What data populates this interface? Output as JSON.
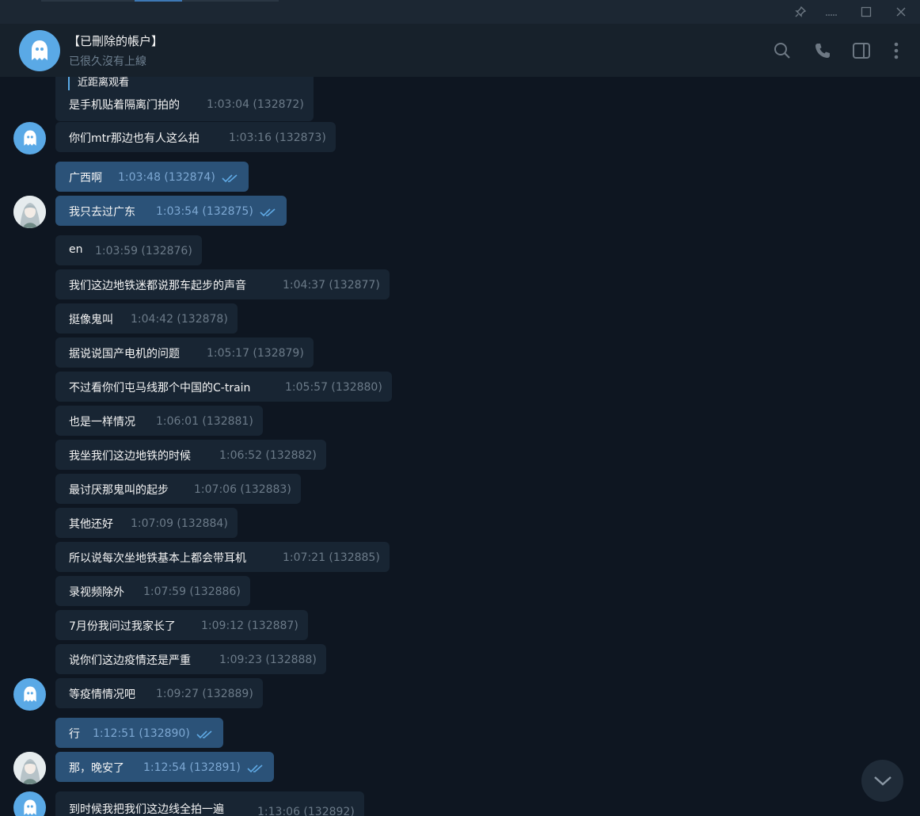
{
  "window": {
    "pin_icon": "pin-icon",
    "minimize_icon": "minimize-icon",
    "maximize_icon": "maximize-icon",
    "close_icon": "close-icon"
  },
  "header": {
    "chat_name": "【已刪除的帳户】",
    "status": "已很久沒有上線",
    "icons": [
      "search-icon",
      "phone-icon",
      "sidebar-toggle-icon",
      "more-vertical-icon"
    ]
  },
  "colors": {
    "background": "#0e1621",
    "header": "#17212b",
    "incoming_bubble": "#182533",
    "outgoing_bubble": "#2b5278",
    "avatar_blue": "#5aa9e6",
    "read_check": "#5fa9e4"
  },
  "messages": [
    {
      "reply": "近距离观看",
      "text": "是手机贴着隔离门拍的",
      "time": "1:03:04 (132872)",
      "out": false
    },
    {
      "text": "你们mtr那边也有人这么拍",
      "time": "1:03:16 (132873)",
      "out": false
    },
    {
      "text": "广西啊",
      "time": "1:03:48 (132874)",
      "out": true
    },
    {
      "text": "我只去过广东",
      "time": "1:03:54 (132875)",
      "out": true
    },
    {
      "text": "en",
      "time": "1:03:59 (132876)",
      "out": false
    },
    {
      "text": "我们这边地铁迷都说那车起步的声音",
      "time": "1:04:37 (132877)",
      "out": false
    },
    {
      "text": "挺像鬼叫",
      "time": "1:04:42 (132878)",
      "out": false
    },
    {
      "text": "据说说国产电机的问题",
      "time": "1:05:17 (132879)",
      "out": false
    },
    {
      "text": "不过看你们屯马线那个中国的C-train",
      "time": "1:05:57 (132880)",
      "out": false
    },
    {
      "text": "也是一样情况",
      "time": "1:06:01 (132881)",
      "out": false
    },
    {
      "text": "我坐我们这边地铁的时候",
      "time": "1:06:52 (132882)",
      "out": false
    },
    {
      "text": "最讨厌那鬼叫的起步",
      "time": "1:07:06 (132883)",
      "out": false
    },
    {
      "text": "其他还好",
      "time": "1:07:09 (132884)",
      "out": false
    },
    {
      "text": "所以说每次坐地铁基本上都会带耳机",
      "time": "1:07:21 (132885)",
      "out": false
    },
    {
      "text": "录视频除外",
      "time": "1:07:59 (132886)",
      "out": false
    },
    {
      "text": "7月份我问过我家长了",
      "time": "1:09:12 (132887)",
      "out": false
    },
    {
      "text": "说你们这边疫情还是严重",
      "time": "1:09:23 (132888)",
      "out": false
    },
    {
      "text": "等疫情情况吧",
      "time": "1:09:27 (132889)",
      "out": false
    },
    {
      "text": "行",
      "time": "1:12:51 (132890)",
      "out": true
    },
    {
      "text": "那，晚安了",
      "time": "1:12:54 (132891)",
      "out": true
    },
    {
      "text": "到时候我把我们这边线全拍一遍",
      "time": "1:13:06 (132892)",
      "out": false
    }
  ],
  "scroll_down_icon": "chevron-down-icon"
}
